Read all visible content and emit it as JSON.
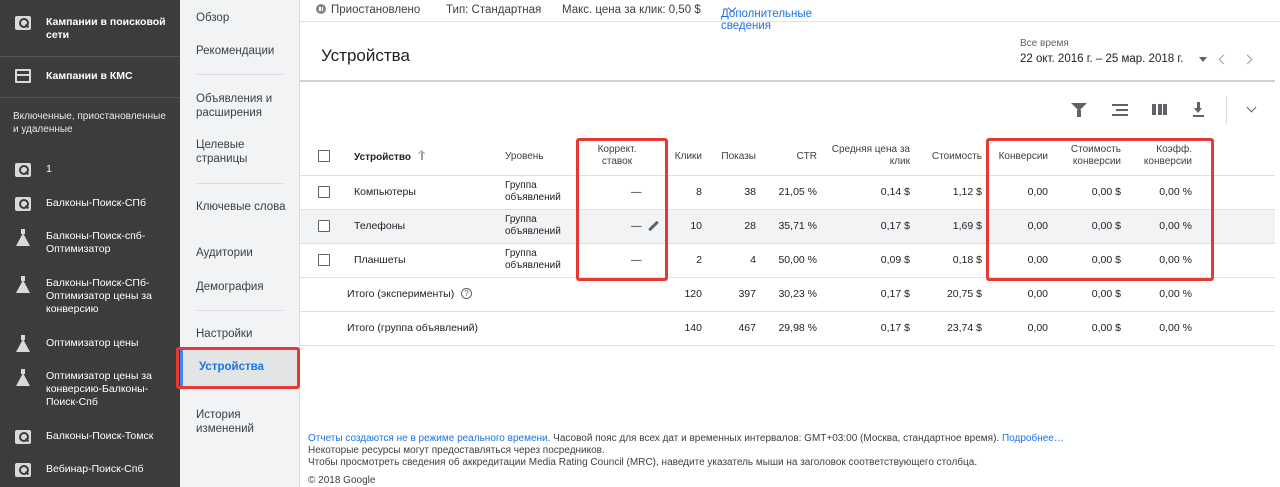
{
  "sidebar": {
    "campaigns": [
      {
        "label": "Кампании в поисковой сети",
        "icon": "search-icon",
        "bold": true
      },
      {
        "label": "Кампании в КМС",
        "icon": "display-icon",
        "bold": true
      }
    ],
    "section_label": "Включенные, приостановленные и удаленные",
    "items": [
      {
        "label": "1",
        "icon": "search-icon"
      },
      {
        "label": "Балконы-Поиск-СПб",
        "icon": "search-icon"
      },
      {
        "label": "Балконы-Поиск-спб-Оптимизатор",
        "icon": "experiment-icon"
      },
      {
        "label": "Балконы-Поиск-СПб-Оптимизатор цены за конверсию",
        "icon": "experiment-icon"
      },
      {
        "label": "Оптимизатор цены",
        "icon": "experiment-icon"
      },
      {
        "label": "Оптимизатор цены за конверсию-Балконы-Поиск-Спб",
        "icon": "experiment-icon"
      },
      {
        "label": "Балконы-Поиск-Томск",
        "icon": "search-icon"
      },
      {
        "label": "Вебинар-Поиск-Спб",
        "icon": "search-icon"
      }
    ]
  },
  "nav": {
    "items": [
      "Обзор",
      "Рекомендации",
      "Объявления и расширения",
      "Целевые страницы",
      "Ключевые слова",
      "Аудитории",
      "Демография",
      "Настройки",
      "Устройства",
      "История изменений"
    ],
    "active": "Устройства"
  },
  "status": {
    "state": "Приостановлено",
    "type": "Тип: Стандартная",
    "max_cpc": "Макс. цена за клик: 0,50 $",
    "details_link": "Дополнительные сведения"
  },
  "header": {
    "title": "Устройства",
    "date_label": "Все время",
    "date_range": "22 окт. 2016 г. – 25 мар. 2018 г."
  },
  "table": {
    "columns": {
      "device": "Устройство",
      "level": "Уровень",
      "bid_adj": "Коррект. ставок",
      "clicks": "Клики",
      "impr": "Показы",
      "ctr": "CTR",
      "avg_cpc": "Средняя цена за клик",
      "cost": "Стоимость",
      "conv": "Конверсии",
      "cost_conv": "Стоимость конверсии",
      "conv_rate": "Коэфф. конверсии"
    },
    "rows": [
      {
        "device": "Компьютеры",
        "level": "Группа объявлений",
        "bid_adj": "—",
        "clicks": "8",
        "impr": "38",
        "ctr": "21,05 %",
        "avg_cpc": "0,14 $",
        "cost": "1,12 $",
        "conv": "0,00",
        "cost_conv": "0,00 $",
        "conv_rate": "0,00 %"
      },
      {
        "device": "Телефоны",
        "level": "Группа объявлений",
        "bid_adj": "—",
        "clicks": "10",
        "impr": "28",
        "ctr": "35,71 %",
        "avg_cpc": "0,17 $",
        "cost": "1,69 $",
        "conv": "0,00",
        "cost_conv": "0,00 $",
        "conv_rate": "0,00 %"
      },
      {
        "device": "Планшеты",
        "level": "Группа объявлений",
        "bid_adj": "—",
        "clicks": "2",
        "impr": "4",
        "ctr": "50,00 %",
        "avg_cpc": "0,09 $",
        "cost": "0,18 $",
        "conv": "0,00",
        "cost_conv": "0,00 $",
        "conv_rate": "0,00 %"
      }
    ],
    "totals": [
      {
        "label": "Итого (эксперименты)",
        "clicks": "120",
        "impr": "397",
        "ctr": "30,23 %",
        "avg_cpc": "0,17 $",
        "cost": "20,75 $",
        "conv": "0,00",
        "cost_conv": "0,00 $",
        "conv_rate": "0,00 %"
      },
      {
        "label": "Итого (группа объявлений)",
        "clicks": "140",
        "impr": "467",
        "ctr": "29,98 %",
        "avg_cpc": "0,17 $",
        "cost": "23,74 $",
        "conv": "0,00",
        "cost_conv": "0,00 $",
        "conv_rate": "0,00 %"
      }
    ]
  },
  "footer": {
    "line1_link": "Отчеты создаются не в режиме реального времени.",
    "line1_text": " Часовой пояс для всех дат и временных интервалов: GMT+03:00 (Москва, стандартное время). ",
    "line1_more": "Подробнее…",
    "line2": "Некоторые ресурсы могут предоставляться через посредников.",
    "line3": "Чтобы просмотреть сведения об аккредитации Media Rating Council (MRC), наведите указатель мыши на заголовок соответствующего столбца.",
    "copyright": "© 2018 Google"
  },
  "colors": {
    "accent": "#1a73e8",
    "highlight": "#e53935",
    "sidebar_bg": "#3c3c3c"
  }
}
